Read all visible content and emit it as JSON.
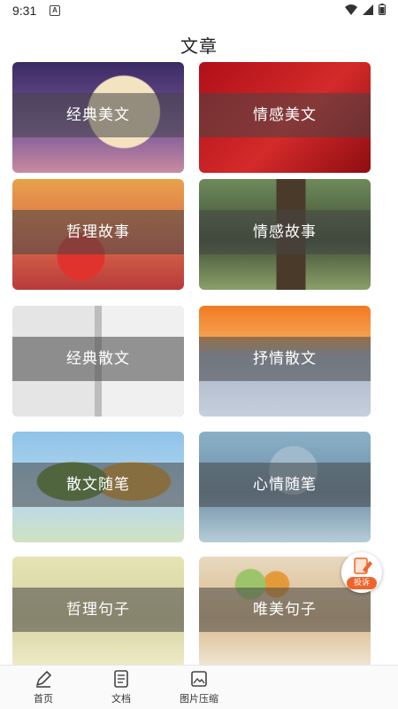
{
  "status_bar": {
    "time": "9:31",
    "notification_badge": "A"
  },
  "app": {
    "title": "文章"
  },
  "categories": [
    {
      "label": "经典美文",
      "bg_colors": [
        "#3a2a63",
        "#7a5a9a",
        "#c98aa0"
      ]
    },
    {
      "label": "情感美文",
      "bg_colors": [
        "#b01018",
        "#d42a2a",
        "#8e0d12"
      ]
    },
    {
      "label": "哲理故事",
      "bg_colors": [
        "#e8a24a",
        "#d96a4a",
        "#b83a3a"
      ]
    },
    {
      "label": "情感故事",
      "bg_colors": [
        "#6e8a5a",
        "#3f4f35",
        "#8aa06a"
      ]
    },
    {
      "label": "经典散文",
      "bg_colors": [
        "#cfcfcf",
        "#9a9a9a",
        "#e5e5e5"
      ]
    },
    {
      "label": "抒情散文",
      "bg_colors": [
        "#f27a22",
        "#a8b4c8",
        "#c6cfdc"
      ]
    },
    {
      "label": "散文随笔",
      "bg_colors": [
        "#8ec3e8",
        "#6a9a3a",
        "#d8a03a"
      ]
    },
    {
      "label": "心情随笔",
      "bg_colors": [
        "#8ab0c8",
        "#6e8fa6",
        "#b7ccd8"
      ]
    },
    {
      "label": "哲理句子",
      "bg_colors": [
        "#e6e3b4",
        "#d7d3a0",
        "#eeebc8"
      ]
    },
    {
      "label": "唯美句子",
      "bg_colors": [
        "#e8d9c0",
        "#d8b98a",
        "#f0e6d4"
      ]
    }
  ],
  "floating_button": {
    "label": "投诉"
  },
  "bottom_nav": [
    {
      "label": "首页",
      "icon": "pen-icon"
    },
    {
      "label": "文档",
      "icon": "document-icon"
    },
    {
      "label": "图片压缩",
      "icon": "image-compress-icon"
    }
  ]
}
